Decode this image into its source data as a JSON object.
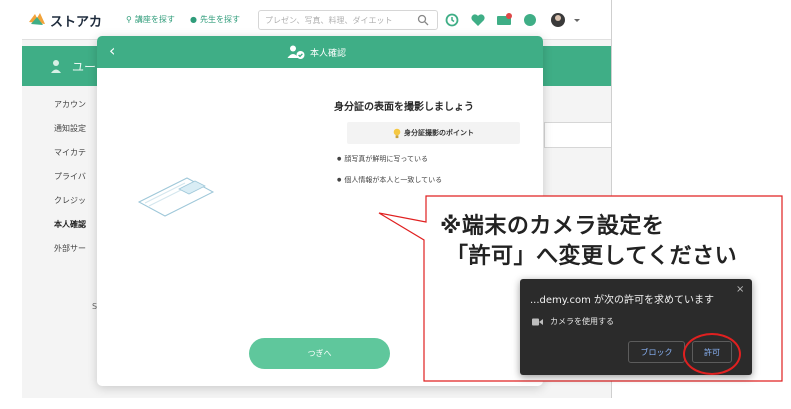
{
  "header": {
    "logo_text": "ストアカ",
    "nav": [
      "講座を探す",
      "先生を探す"
    ],
    "search_placeholder": "プレゼン、写真、料理、ダイエット"
  },
  "subheader": {
    "title": "ユー"
  },
  "sidebar": {
    "items": [
      {
        "label": "アカウン"
      },
      {
        "label": "通知設定"
      },
      {
        "label": "マイカテ"
      },
      {
        "label": "プライバ"
      },
      {
        "label": "クレジッ"
      },
      {
        "label": "本人確認"
      },
      {
        "label": "外部サー"
      }
    ],
    "s_fragment": "S"
  },
  "modal": {
    "back": "‹",
    "title": "本人確認",
    "heading": "身分証の表面を撮影しましょう",
    "tip_label": "身分証撮影のポイント",
    "bullets": [
      "顔写真が鮮明に写っている",
      "個人情報が本人と一致している"
    ],
    "next_button": "つぎへ"
  },
  "callout": {
    "line1": "※端末のカメラ設定を",
    "line2": "「許可」へ変更してください",
    "color": "#e02020"
  },
  "permission_prompt": {
    "title": "...demy.com が次の許可を求めています",
    "close": "×",
    "camera_text": "カメラを使用する",
    "block_button": "ブロック",
    "allow_button": "許可"
  },
  "colors": {
    "brand_green": "#3fae86",
    "button_green": "#5fc79c",
    "prompt_bg": "#2b2b2b",
    "prompt_link": "#8ab4f8"
  }
}
